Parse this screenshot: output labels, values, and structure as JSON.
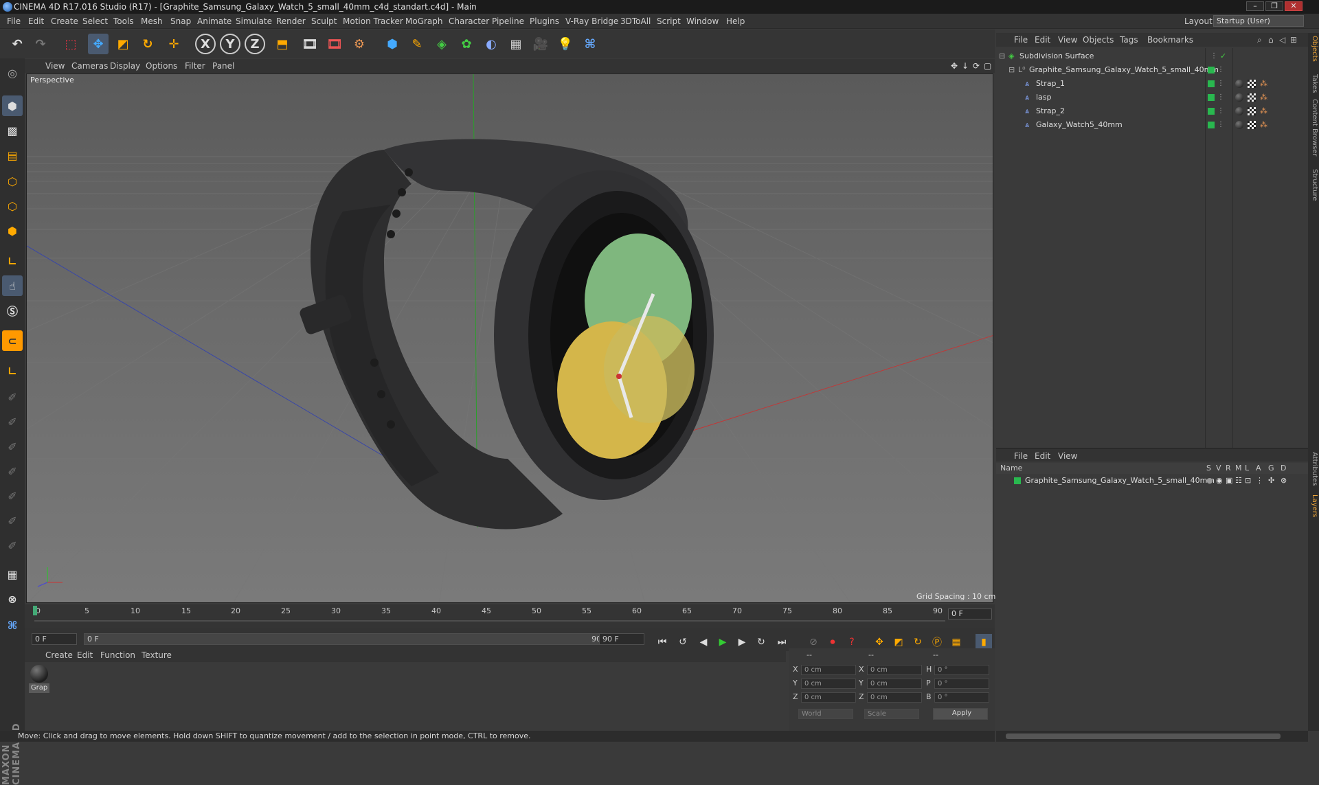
{
  "window": {
    "title": "CINEMA 4D R17.016 Studio (R17) - [Graphite_Samsung_Galaxy_Watch_5_small_40mm_c4d_standart.c4d] - Main",
    "controls": [
      "–",
      "❐",
      "✕"
    ]
  },
  "menubar": {
    "items": [
      "File",
      "Edit",
      "Create",
      "Select",
      "Tools",
      "Mesh",
      "Snap",
      "Animate",
      "Simulate",
      "Render",
      "Sculpt",
      "Motion Tracker",
      "MoGraph",
      "Character",
      "Pipeline",
      "Plugins",
      "V-Ray Bridge",
      "3DToAll",
      "Script",
      "Window",
      "Help"
    ],
    "layout_label": "Layout:",
    "layout_value": "Startup (User)"
  },
  "toolbar": {
    "axis_x": "X",
    "axis_y": "Y",
    "axis_z": "Z"
  },
  "viewport": {
    "menu": [
      "View",
      "Cameras",
      "Display",
      "Options",
      "Filter",
      "Panel"
    ],
    "label": "Perspective",
    "grid_spacing": "Grid Spacing : 10 cm",
    "watch_face_colors": {
      "green": "#7fb77e",
      "yellow": "#d4b64a"
    }
  },
  "timeline": {
    "ticks": [
      "0",
      "5",
      "10",
      "15",
      "20",
      "25",
      "30",
      "35",
      "40",
      "45",
      "50",
      "55",
      "60",
      "65",
      "70",
      "75",
      "80",
      "85",
      "90"
    ],
    "end_field": "0 F"
  },
  "transport": {
    "start_frame": "0 F",
    "range_start": "0 F",
    "range_end": "90 F",
    "end_frame": "90 F"
  },
  "material_manager": {
    "menu": [
      "Create",
      "Edit",
      "Function",
      "Texture"
    ],
    "material_name": "Grap"
  },
  "coordinates": {
    "header": [
      "--",
      "--",
      "--"
    ],
    "rows": [
      {
        "label": "X",
        "pos": "0 cm",
        "label2": "X",
        "size": "0 cm",
        "label3": "H",
        "rot": "0 °"
      },
      {
        "label": "Y",
        "pos": "0 cm",
        "label2": "Y",
        "size": "0 cm",
        "label3": "P",
        "rot": "0 °"
      },
      {
        "label": "Z",
        "pos": "0 cm",
        "label2": "Z",
        "size": "0 cm",
        "label3": "B",
        "rot": "0 °"
      }
    ],
    "world_select": "World",
    "scale_select": "Scale",
    "apply_label": "Apply"
  },
  "statusbar": {
    "text": "Move: Click and drag to move elements. Hold down SHIFT to quantize movement / add to the selection in point mode, CTRL to remove."
  },
  "object_manager": {
    "menu": [
      "File",
      "Edit",
      "View",
      "Objects",
      "Tags",
      "Bookmarks"
    ],
    "objects": [
      {
        "name": "Subdivision Surface",
        "level": 0
      },
      {
        "name": "Graphite_Samsung_Galaxy_Watch_5_small_40mm",
        "level": 1
      },
      {
        "name": "Strap_1",
        "level": 2
      },
      {
        "name": "lasp",
        "level": 2
      },
      {
        "name": "Strap_2",
        "level": 2
      },
      {
        "name": "Galaxy_Watch5_40mm",
        "level": 2
      }
    ]
  },
  "layers": {
    "menu": [
      "File",
      "Edit",
      "View"
    ],
    "columns": {
      "name": "Name",
      "flags": [
        "S",
        "V",
        "R",
        "M",
        "L",
        "A",
        "G",
        "D"
      ]
    },
    "items": [
      {
        "name": "Graphite_Samsung_Galaxy_Watch_5_small_40mm",
        "color": "#29b84f"
      }
    ]
  },
  "right_tabs": [
    "Objects",
    "Takes",
    "Content Browser",
    "Structure",
    "Attributes",
    "Layers"
  ],
  "maxon_logo": "MAXON CINEMA 4D"
}
